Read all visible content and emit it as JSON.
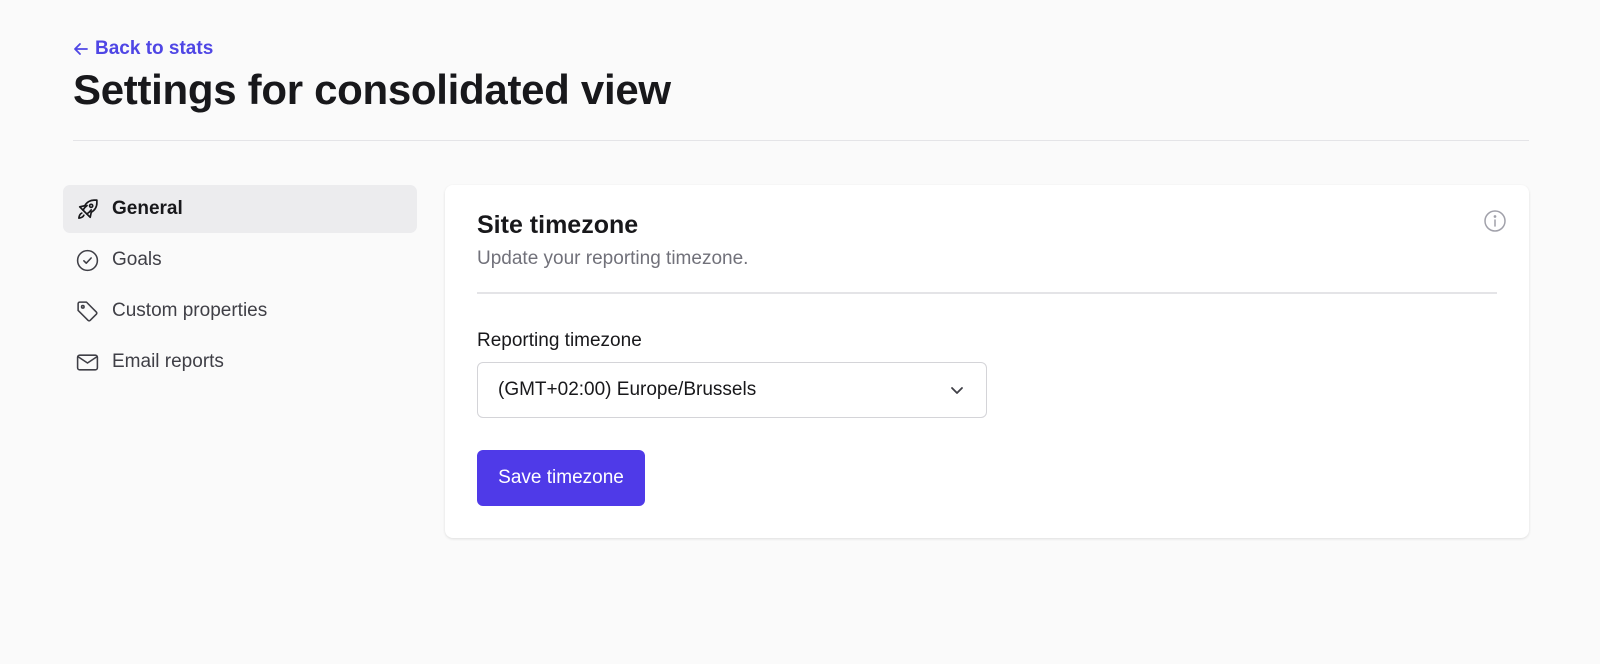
{
  "header": {
    "back_link": "Back to stats",
    "title": "Settings for consolidated view"
  },
  "sidebar": {
    "items": [
      {
        "label": "General",
        "icon": "rocket-icon",
        "active": true
      },
      {
        "label": "Goals",
        "icon": "check-circle-icon",
        "active": false
      },
      {
        "label": "Custom properties",
        "icon": "tag-icon",
        "active": false
      },
      {
        "label": "Email reports",
        "icon": "envelope-icon",
        "active": false
      }
    ]
  },
  "main": {
    "card": {
      "title": "Site timezone",
      "subtitle": "Update your reporting timezone.",
      "info_icon": "info-icon",
      "field_label": "Reporting timezone",
      "selected_timezone": "(GMT+02:00) Europe/Brussels",
      "save_label": "Save timezone"
    }
  },
  "colors": {
    "accent": "#4f46e5",
    "button": "#4f3ae8",
    "background": "#fafafa",
    "active_nav": "#ececee"
  }
}
